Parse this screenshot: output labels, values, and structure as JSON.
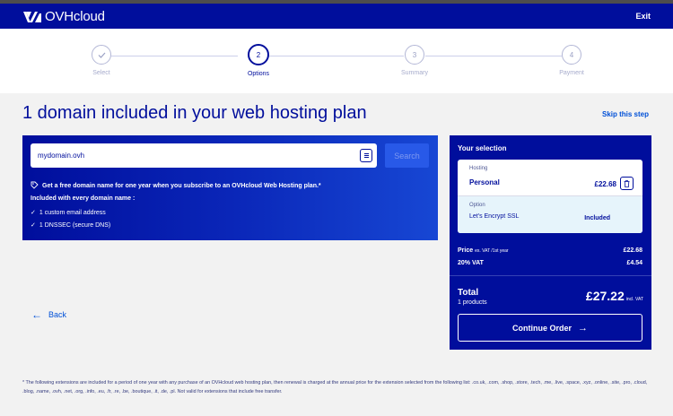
{
  "header": {
    "brand": "OVHcloud",
    "exit_label": "Exit"
  },
  "stepper": {
    "steps": [
      {
        "number": "",
        "label": "Select",
        "state": "done"
      },
      {
        "number": "2",
        "label": "Options",
        "state": "active"
      },
      {
        "number": "3",
        "label": "Summary",
        "state": "pending"
      },
      {
        "number": "4",
        "label": "Payment",
        "state": "pending"
      }
    ],
    "done_icon": "check-icon"
  },
  "main": {
    "title": "1 domain included in your web hosting plan",
    "skip_label": "Skip this step"
  },
  "search": {
    "value": "mydomain.ovh",
    "search_label": "Search",
    "input_icon": "list-icon",
    "promo_icon": "tag-icon",
    "promo": "Get a free domain name for one year when you subscribe to an OVHcloud Web Hosting plan.*",
    "included_title": "Included with every domain name :",
    "features": [
      "1 custom email address",
      "1 DNSSEC (secure DNS)"
    ]
  },
  "back": {
    "label": "Back",
    "icon": "arrow-left-icon"
  },
  "selection": {
    "title": "Your selection",
    "hosting_label": "Hosting",
    "hosting_name": "Personal",
    "hosting_price": "£22.68",
    "trash_icon": "trash-icon",
    "option_label": "Option",
    "option_name": "Let's Encrypt SSL",
    "option_status": "Included",
    "price_label": "Price",
    "price_note": "ex. VAT /1st year",
    "price_value": "£22.68",
    "vat_label": "20% VAT",
    "vat_value": "£4.54",
    "total_label": "Total",
    "total_sub": "1 products",
    "total_value": "£27.22",
    "total_incl": "incl. VAT",
    "continue_label": "Continue Order",
    "continue_icon": "arrow-right-icon"
  },
  "footnote": "* The following extensions are included for a period of one year with any purchase of an OVHcloud web hosting plan, then renewal is charged at the annual price for the extension selected from the following list: .co.uk, .com, .shop, .store, .tech, .me, .live, .space, .xyz, .online, .site, .pro, .cloud, .blog, .name, .ovh, .net, .org, .info, .eu, .fr, .re, .be, .boutique, .it, .de, .pl. Not valid for extensions that include free transfer.",
  "colors": {
    "brand": "#000e9c",
    "accent": "#0050d7",
    "search_button": "#2859e8",
    "option_bg": "#e6f4fb"
  }
}
